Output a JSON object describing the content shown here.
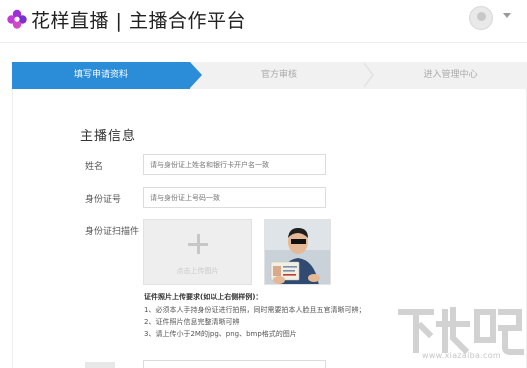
{
  "header": {
    "brand": "花样直播 | 主播合作平台",
    "logo_icon": "flower-logo-icon",
    "avatar_icon": "user-avatar-icon",
    "caret_icon": "chevron-down-icon",
    "brand_color": "#8a2be2"
  },
  "steps": [
    {
      "label": "填写申请资料",
      "active": true
    },
    {
      "label": "官方审核",
      "active": false
    },
    {
      "label": "进入管理中心",
      "active": false
    }
  ],
  "accent_color": "#2b8cd8",
  "form": {
    "section_title": "主播信息",
    "name": {
      "label": "姓名",
      "placeholder": "请与身份证上姓名和银行卡开户名一致",
      "value": ""
    },
    "id_number": {
      "label": "身份证号",
      "placeholder": "请与身份证上号码一致",
      "value": ""
    },
    "id_scan": {
      "label": "身份证扫描件",
      "upload_text": "点击上传图片",
      "upload_icon": "plus-icon",
      "sample_photo_icon": "sample-id-photo"
    },
    "requirements": {
      "title": "证件照片上传要求(如以上右侧样例)：",
      "lines": [
        "1、必须本人手持身份证进行拍照，同时需要拍本人脸且五官清晰可辨；",
        "2、证件照片信息完整清晰可辨",
        "3、请上传小于2M的jpg、png、bmp格式的图片"
      ]
    }
  },
  "watermark": {
    "text": "下载吧",
    "url": "www.xiazaiba.com"
  }
}
